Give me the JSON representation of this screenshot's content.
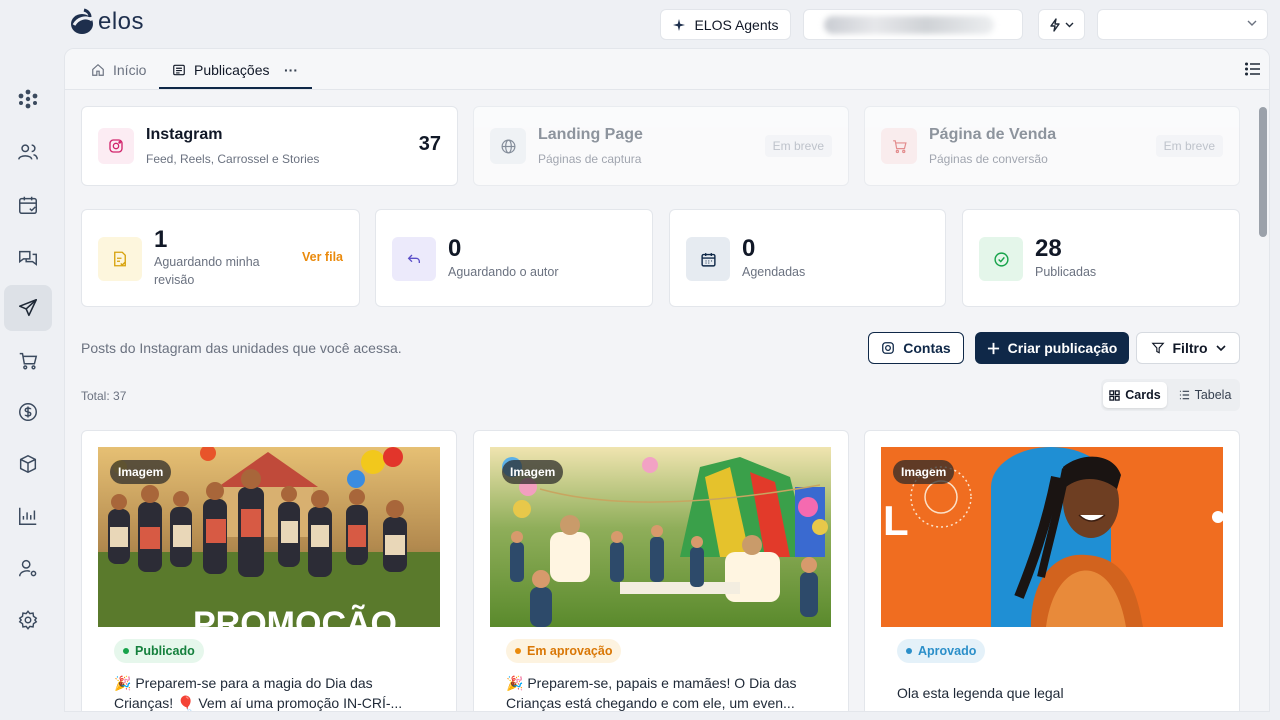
{
  "brand": {
    "name": "elos",
    "color": "#1e2f4d"
  },
  "topbar": {
    "agents_label": "ELOS Agents"
  },
  "sidebar": {
    "items": [
      {
        "icon": "network-icon"
      },
      {
        "icon": "users-icon"
      },
      {
        "icon": "calendar-check-icon"
      },
      {
        "icon": "chat-icon"
      },
      {
        "icon": "send-icon",
        "active": true
      },
      {
        "icon": "cart-icon"
      },
      {
        "icon": "dollar-icon"
      },
      {
        "icon": "box-icon"
      },
      {
        "icon": "chart-icon"
      },
      {
        "icon": "user-settings-icon"
      },
      {
        "icon": "gear-icon"
      }
    ]
  },
  "tabs": [
    {
      "label": "Início",
      "icon": "home-icon"
    },
    {
      "label": "Publicações",
      "icon": "list-icon",
      "active": true
    },
    {
      "label": "···"
    }
  ],
  "channels": [
    {
      "title": "Instagram",
      "subtitle": "Feed, Reels, Carrossel e Stories",
      "count": "37"
    },
    {
      "title": "Landing Page",
      "subtitle": "Páginas de captura",
      "badge": "Em breve"
    },
    {
      "title": "Página de Venda",
      "subtitle": "Páginas de conversão",
      "badge": "Em breve"
    }
  ],
  "stats": [
    {
      "value": "1",
      "label": "Aguardando minha revisão",
      "action": "Ver fila"
    },
    {
      "value": "0",
      "label": "Aguardando o autor"
    },
    {
      "value": "0",
      "label": "Agendadas"
    },
    {
      "value": "28",
      "label": "Publicadas"
    }
  ],
  "description": "Posts do Instagram das unidades que você acessa.",
  "actions": {
    "accounts": "Contas",
    "create": "Criar publicação",
    "filter": "Filtro"
  },
  "total_label": "Total: 37",
  "view_toggle": {
    "cards": "Cards",
    "table": "Tabela"
  },
  "posts": [
    {
      "tag": "Imagem",
      "status": "Publicado",
      "caption": "🎉 Preparem-se para a magia do Dia das Crianças! 🎈 Vem aí uma promoção IN-CRÍ-...",
      "overlay_text": "PROMOÇÃO"
    },
    {
      "tag": "Imagem",
      "status": "Em aprovação",
      "caption": "🎉 Preparem-se, papais e mamães! O Dia das Crianças está chegando e com ele, um even..."
    },
    {
      "tag": "Imagem",
      "status": "Aprovado",
      "caption": "Ola esta legenda que legal",
      "overlay_text": "L"
    }
  ],
  "colors": {
    "primary": "#0f2848",
    "published": "#16a34a",
    "pending": "#ea8a0c",
    "approved": "#2b8fc9"
  }
}
